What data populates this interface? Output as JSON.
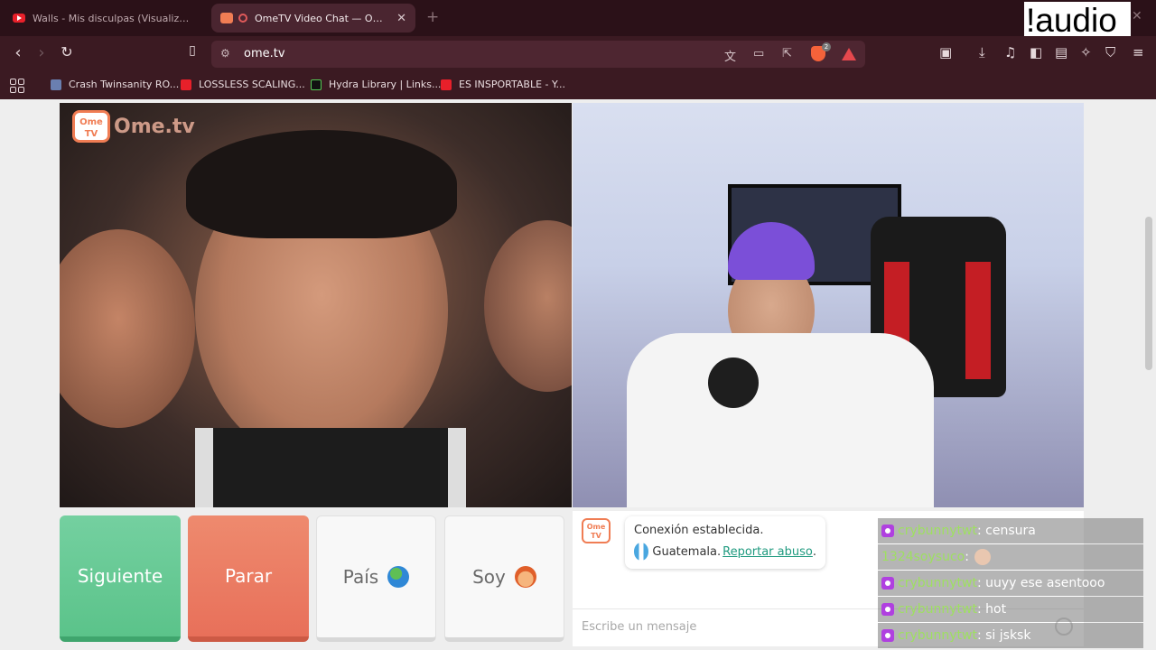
{
  "browser": {
    "tabs": [
      {
        "title": "Walls - Mis disculpas (Visualizer) - Yo",
        "active": false
      },
      {
        "title": "OmeTV Video Chat — Omegl",
        "active": true
      }
    ],
    "new_tab": "+",
    "url": "ome.tv",
    "bookmarks": [
      {
        "label": "Crash Twinsanity RO..."
      },
      {
        "label": "LOSSLESS SCALING..."
      },
      {
        "label": "Hydra Library | Links..."
      },
      {
        "label": "ES INSPORTABLE - Y..."
      }
    ],
    "brave_badge": "2"
  },
  "overlay_label": "!audio",
  "omegle": {
    "logo_tv": "Ome TV",
    "logo_word": "Ome.tv",
    "buttons": {
      "next": "Siguiente",
      "stop": "Parar",
      "country": "País",
      "iam": "Soy"
    },
    "chat": {
      "logo": "Ome TV",
      "status": "Conexión establecida.",
      "country": "Guatemala.",
      "report": "Reportar abuso",
      "report_suffix": ".",
      "input_placeholder": "Escribe un mensaje"
    }
  },
  "stream_chat": [
    {
      "user": "crybunnytwt",
      "text": ": censura"
    },
    {
      "user": "1324soysuco",
      "text": ":"
    },
    {
      "user": "crybunnytwt",
      "text": ": uuyy ese asentooo"
    },
    {
      "user": "crybunnytwt",
      "text": ": hot"
    },
    {
      "user": "crybunnytwt",
      "text": ": si jsksk"
    }
  ],
  "colors": {
    "next": "#5bc38a",
    "stop": "#e8705a",
    "accent": "#f07d54",
    "chat_user": "#9ee060"
  }
}
